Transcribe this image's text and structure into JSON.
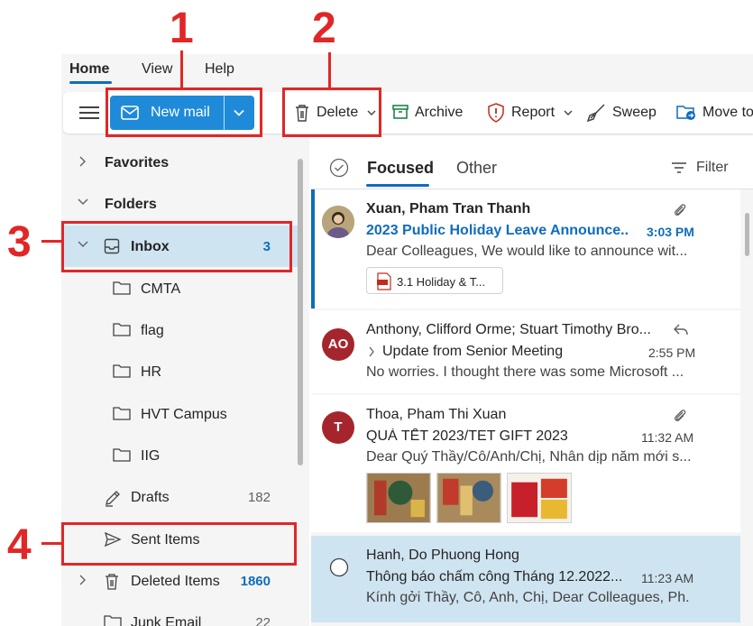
{
  "tabs": [
    "Home",
    "View",
    "Help"
  ],
  "ribbon": {
    "new_mail": "New mail",
    "delete": "Delete",
    "archive": "Archive",
    "report": "Report",
    "sweep": "Sweep",
    "move_to": "Move to"
  },
  "annotations": [
    "1",
    "2",
    "3",
    "4"
  ],
  "folders": {
    "favorites": "Favorites",
    "folders": "Folders",
    "inbox": {
      "label": "Inbox",
      "count": "3"
    },
    "subfolders": [
      "CMTA",
      "flag",
      "HR",
      "HVT Campus",
      "IIG"
    ],
    "drafts": {
      "label": "Drafts",
      "count": "182"
    },
    "sent": {
      "label": "Sent Items"
    },
    "deleted": {
      "label": "Deleted Items",
      "count": "1860"
    },
    "junk": {
      "label": "Junk Email",
      "count": "22"
    }
  },
  "list": {
    "focused": "Focused",
    "other": "Other",
    "filter": "Filter"
  },
  "messages": [
    {
      "sender": "Xuan, Pham Tran Thanh",
      "subject": "2023 Public Holiday Leave Announce...",
      "time": "3:03 PM",
      "preview": "Dear Colleagues, We would like to announce wit...",
      "attachment": "3.1 Holiday & T..."
    },
    {
      "initials": "AO",
      "sender": "Anthony, Clifford Orme; Stuart Timothy Bro...",
      "subject": "Update from Senior Meeting",
      "time": "2:55 PM",
      "preview": "No worries. I thought there was some Microsoft ..."
    },
    {
      "initials": "T",
      "sender": "Thoa, Pham Thi Xuan",
      "subject": "QUÀ TẾT 2023/TET GIFT 2023",
      "time": "11:32 AM",
      "preview": "Dear Quý Thầy/Cô/Anh/Chị, Nhân dịp năm mới s..."
    },
    {
      "sender": "Hanh, Do Phuong Hong",
      "subject": "Thông báo chấm công Tháng 12.2022...",
      "time": "11:23 AM",
      "preview": "Kính gởi Thầy, Cô, Anh, Chị, Dear Colleagues, Ph..."
    }
  ],
  "colors": {
    "accent": "#0f6cbd",
    "new_mail_bg": "#1f8ad8",
    "annotation": "#e02727",
    "selected": "#cfe4f1"
  }
}
